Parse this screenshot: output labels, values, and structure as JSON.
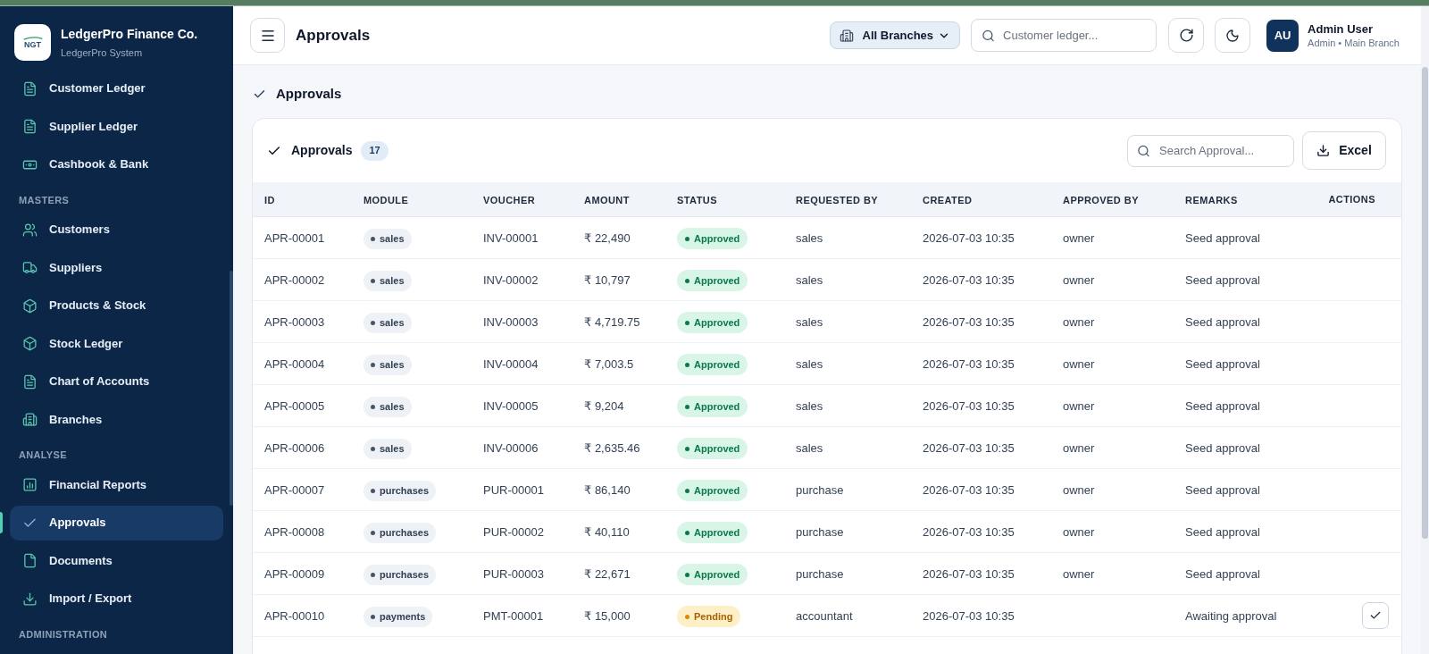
{
  "sidebar": {
    "brand": {
      "logo_text": "NGT",
      "name": "LedgerPro Finance Co.",
      "subtitle": "LedgerPro System"
    },
    "sections": [
      {
        "items": [
          {
            "label": "Customer Ledger",
            "selected": false
          },
          {
            "label": "Supplier Ledger",
            "selected": false
          },
          {
            "label": "Cashbook & Bank",
            "selected": false
          }
        ]
      },
      {
        "title": "MASTERS",
        "items": [
          {
            "label": "Customers",
            "selected": false
          },
          {
            "label": "Suppliers",
            "selected": false
          },
          {
            "label": "Products & Stock",
            "selected": false
          },
          {
            "label": "Stock Ledger",
            "selected": false
          },
          {
            "label": "Chart of Accounts",
            "selected": false
          },
          {
            "label": "Branches",
            "selected": false
          }
        ]
      },
      {
        "title": "ANALYSE",
        "items": [
          {
            "label": "Financial Reports",
            "selected": false
          },
          {
            "label": "Approvals",
            "selected": true
          },
          {
            "label": "Documents",
            "selected": false
          },
          {
            "label": "Import / Export",
            "selected": false
          }
        ]
      },
      {
        "title": "ADMINISTRATION"
      }
    ]
  },
  "header": {
    "page_title": "Approvals",
    "branch_selector": "All Branches",
    "search": {
      "placeholder": "Customer ledger..."
    },
    "user": {
      "initials": "AU",
      "name": "Admin User",
      "role": "Admin • Main Branch"
    }
  },
  "breadcrumb": "Approvals",
  "card": {
    "title": "Approvals",
    "count": "17",
    "search": {
      "placeholder": "Search Approval..."
    },
    "export_button": "Excel",
    "table": {
      "columns": [
        "ID",
        "MODULE",
        "VOUCHER",
        "AMOUNT",
        "STATUS",
        "REQUESTED BY",
        "CREATED",
        "APPROVED BY",
        "REMARKS",
        "ACTIONS"
      ],
      "rows": [
        {
          "id": "APR-00001",
          "module": "sales",
          "voucher": "INV-00001",
          "amount": "₹ 22,490",
          "status": {
            "label": "Approved",
            "kind": "approved"
          },
          "requested_by": "sales",
          "created": "2026-07-03 10:35",
          "approved_by": "owner",
          "remarks": "Seed approval",
          "approvable": false
        },
        {
          "id": "APR-00002",
          "module": "sales",
          "voucher": "INV-00002",
          "amount": "₹ 10,797",
          "status": {
            "label": "Approved",
            "kind": "approved"
          },
          "requested_by": "sales",
          "created": "2026-07-03 10:35",
          "approved_by": "owner",
          "remarks": "Seed approval",
          "approvable": false
        },
        {
          "id": "APR-00003",
          "module": "sales",
          "voucher": "INV-00003",
          "amount": "₹ 4,719.75",
          "status": {
            "label": "Approved",
            "kind": "approved"
          },
          "requested_by": "sales",
          "created": "2026-07-03 10:35",
          "approved_by": "owner",
          "remarks": "Seed approval",
          "approvable": false
        },
        {
          "id": "APR-00004",
          "module": "sales",
          "voucher": "INV-00004",
          "amount": "₹ 7,003.5",
          "status": {
            "label": "Approved",
            "kind": "approved"
          },
          "requested_by": "sales",
          "created": "2026-07-03 10:35",
          "approved_by": "owner",
          "remarks": "Seed approval",
          "approvable": false
        },
        {
          "id": "APR-00005",
          "module": "sales",
          "voucher": "INV-00005",
          "amount": "₹ 9,204",
          "status": {
            "label": "Approved",
            "kind": "approved"
          },
          "requested_by": "sales",
          "created": "2026-07-03 10:35",
          "approved_by": "owner",
          "remarks": "Seed approval",
          "approvable": false
        },
        {
          "id": "APR-00006",
          "module": "sales",
          "voucher": "INV-00006",
          "amount": "₹ 2,635.46",
          "status": {
            "label": "Approved",
            "kind": "approved"
          },
          "requested_by": "sales",
          "created": "2026-07-03 10:35",
          "approved_by": "owner",
          "remarks": "Seed approval",
          "approvable": false
        },
        {
          "id": "APR-00007",
          "module": "purchases",
          "voucher": "PUR-00001",
          "amount": "₹ 86,140",
          "status": {
            "label": "Approved",
            "kind": "approved"
          },
          "requested_by": "purchase",
          "created": "2026-07-03 10:35",
          "approved_by": "owner",
          "remarks": "Seed approval",
          "approvable": false
        },
        {
          "id": "APR-00008",
          "module": "purchases",
          "voucher": "PUR-00002",
          "amount": "₹ 40,110",
          "status": {
            "label": "Approved",
            "kind": "approved"
          },
          "requested_by": "purchase",
          "created": "2026-07-03 10:35",
          "approved_by": "owner",
          "remarks": "Seed approval",
          "approvable": false
        },
        {
          "id": "APR-00009",
          "module": "purchases",
          "voucher": "PUR-00003",
          "amount": "₹ 22,671",
          "status": {
            "label": "Approved",
            "kind": "approved"
          },
          "requested_by": "purchase",
          "created": "2026-07-03 10:35",
          "approved_by": "owner",
          "remarks": "Seed approval",
          "approvable": false
        },
        {
          "id": "APR-00010",
          "module": "payments",
          "voucher": "PMT-00001",
          "amount": "₹ 15,000",
          "status": {
            "label": "Pending",
            "kind": "pending"
          },
          "requested_by": "accountant",
          "created": "2026-07-03 10:35",
          "remarks": "Awaiting approval",
          "approvable": true
        }
      ]
    }
  }
}
